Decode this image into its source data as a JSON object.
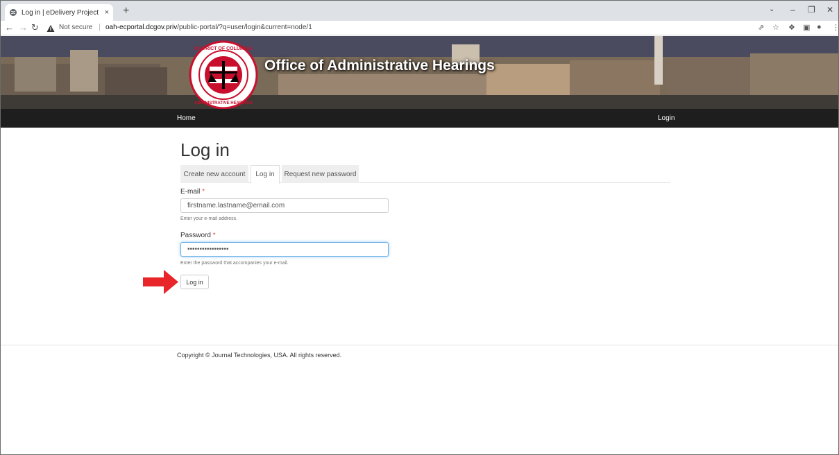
{
  "browser": {
    "tab_title": "Log in | eDelivery Project",
    "tab_close": "×",
    "new_tab": "+",
    "not_secure": "Not secure",
    "url_separator": "|",
    "url_host": "oah-ecportal.dcgov.priv",
    "url_path": "/public-portal/?q=user/login&current=node/1",
    "icons": [
      "back-arrow",
      "forward-arrow",
      "reload",
      "warning-triangle",
      "share",
      "star",
      "extensions-puzzle",
      "side-panel",
      "profile",
      "menu-kebab"
    ]
  },
  "header": {
    "site_title": "Office of Administrative Hearings"
  },
  "nav": {
    "home": "Home",
    "login": "Login"
  },
  "page": {
    "title": "Log in",
    "tabs": [
      "Create new account",
      "Log in",
      "Request new password"
    ],
    "active_tab": "Log in"
  },
  "form": {
    "email_label": "E-mail",
    "email_value": "firstname.lastname@email.com",
    "email_help": "Enter your e-mail address.",
    "password_label": "Password",
    "password_value": "•••••••••••••••••",
    "password_help": "Enter the password that accompanies your e-mail.",
    "required_mark": "*",
    "submit_label": "Log in"
  },
  "footer": {
    "copyright": "Copyright © Journal Technologies, USA. All rights reserved."
  },
  "colors": {
    "navbar": "#1e1e1e",
    "required": "#d9534f",
    "annotation_arrow": "#e8262a",
    "focus_border": "#66afe9"
  }
}
